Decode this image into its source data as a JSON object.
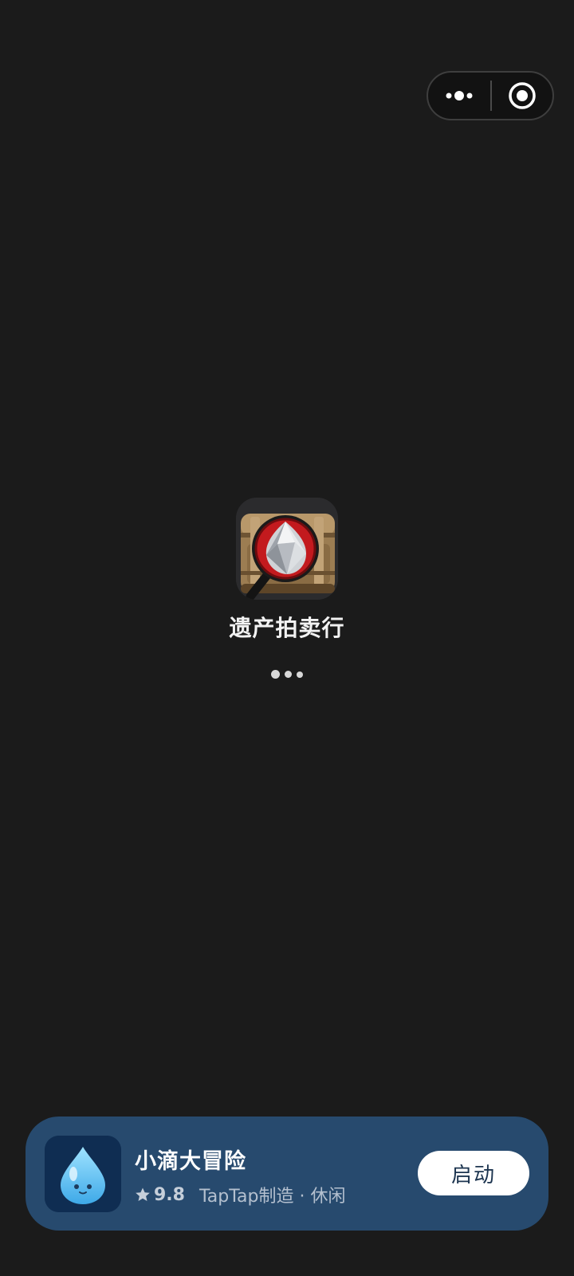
{
  "menu": {
    "more_icon": "more-dots-icon",
    "close_icon": "target-close-icon"
  },
  "launch": {
    "app_icon": "treasure-case-magnifier-icon",
    "app_name": "遗产拍卖行",
    "loading": "loading-dots"
  },
  "promo": {
    "icon": "water-drop-icon",
    "title": "小滴大冒险",
    "rating": "9.8",
    "meta": "TapTap制造 · 休闲",
    "button_label": "启动"
  },
  "colors": {
    "background": "#1b1b1b",
    "card": "#274a6e",
    "button": "#ffffff"
  }
}
